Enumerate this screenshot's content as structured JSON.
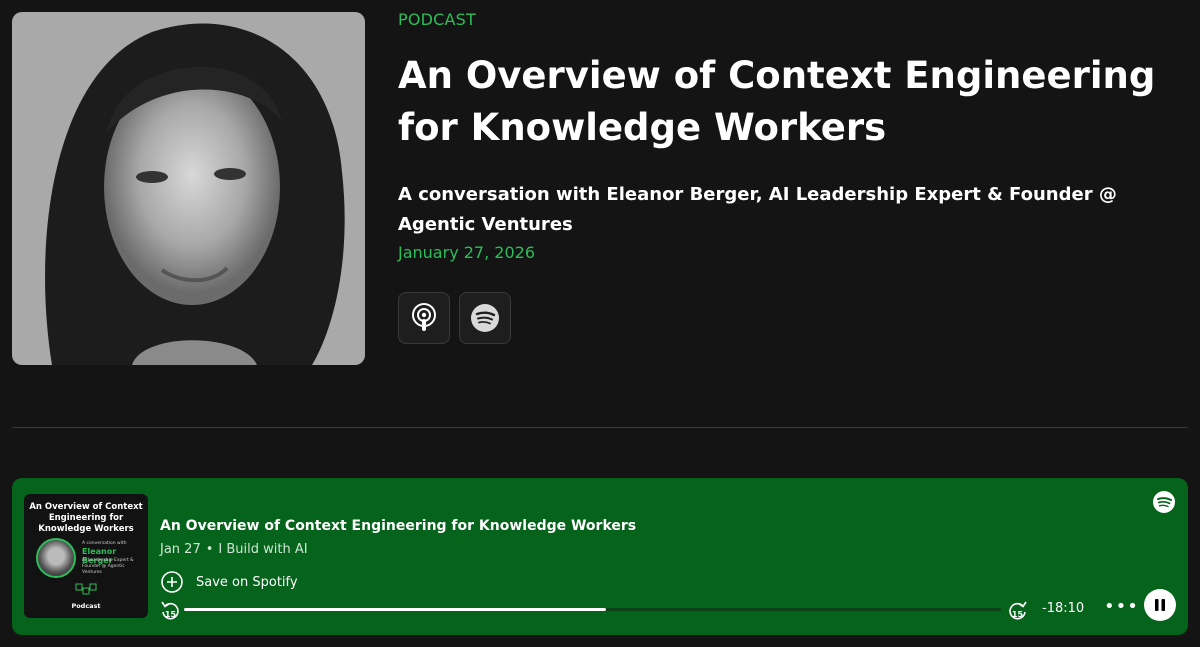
{
  "hero": {
    "kicker": "PODCAST",
    "title": "An Overview of Context Engineering for Knowledge Workers",
    "subtitle": "A conversation with Eleanor Berger, AI Leadership Expert & Founder @ Agentic Ventures",
    "date": "January 27, 2026",
    "platforms": [
      {
        "icon": "apple-podcasts-icon"
      },
      {
        "icon": "spotify-icon"
      }
    ]
  },
  "player": {
    "thumbnail": {
      "title": "An Overview of Context Engineering for Knowledge Workers",
      "conversation": "A conversation with",
      "guest_name": "Eleanor Berger",
      "guest_role": "AI Leadership Expert & Founder @ Agentic Ventures",
      "podcast": "Podcast"
    },
    "episode_title": "An Overview of Context Engineering for Knowledge Workers",
    "date": "Jan 27",
    "separator": "•",
    "show": "I Build with AI",
    "save_label": "Save on Spotify",
    "skip_back_seconds": "15",
    "skip_forward_seconds": "15",
    "progress_fraction": 0.517,
    "remaining_time": "-18:10",
    "more_label": "•••",
    "accent": "#06631c",
    "green": "#2dbd5a"
  }
}
